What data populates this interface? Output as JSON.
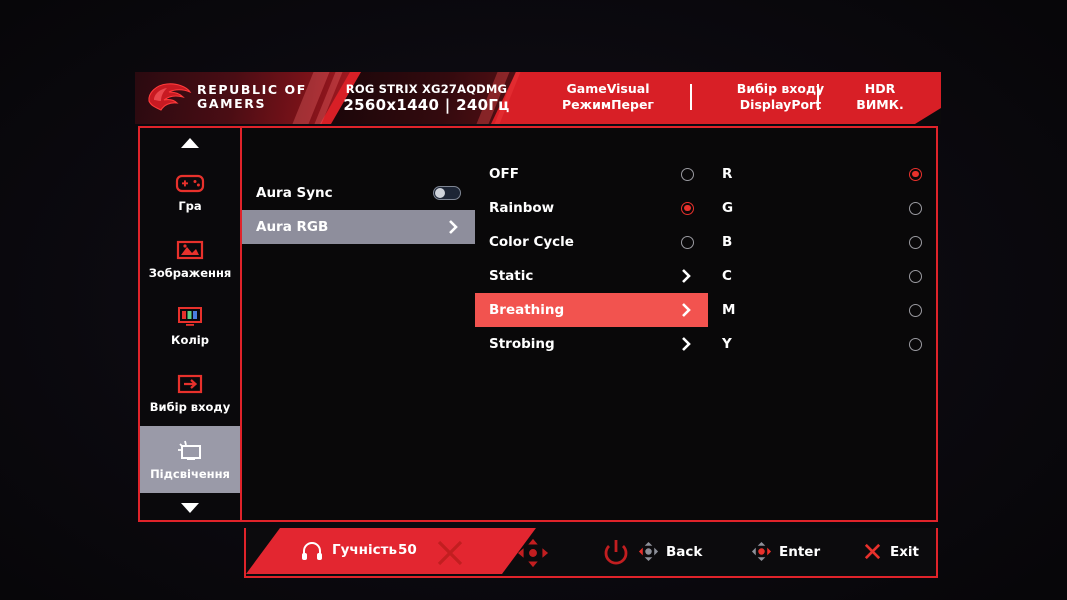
{
  "header": {
    "logo_text_line1": "REPUBLIC OF",
    "logo_text_line2": "GAMERS",
    "model_name": "ROG STRIX XG27AQDMG",
    "model_spec": "2560x1440  |  240Гц",
    "items": [
      {
        "label": "GameVisual",
        "value": "РежимПерег"
      },
      {
        "label": "Вибір входу",
        "value": "DisplayPort"
      },
      {
        "label": "HDR",
        "value": "ВИМК."
      }
    ]
  },
  "sidebar": {
    "scroll_up": "scroll-up-arrow",
    "scroll_down": "scroll-down-arrow",
    "items": [
      {
        "label": "Гра",
        "icon": "gamepad-icon",
        "selected": false
      },
      {
        "label": "Зображення",
        "icon": "image-icon",
        "selected": false
      },
      {
        "label": "Колір",
        "icon": "color-bars-icon",
        "selected": false
      },
      {
        "label": "Вибір входу",
        "icon": "input-arrow-icon",
        "selected": false
      },
      {
        "label": "Підсвічення",
        "icon": "lighting-monitor-icon",
        "selected": true
      }
    ]
  },
  "column2": {
    "rows": [
      {
        "label": "Aura Sync",
        "control": "toggle",
        "value": "off",
        "selected": false
      },
      {
        "label": "Aura RGB",
        "control": "chevron",
        "selected": true
      }
    ]
  },
  "column3": {
    "rows": [
      {
        "label": "OFF",
        "control": "radio",
        "checked": false,
        "selected": false
      },
      {
        "label": "Rainbow",
        "control": "radio",
        "checked": true,
        "selected": false
      },
      {
        "label": "Color Cycle",
        "control": "radio",
        "checked": false,
        "selected": false
      },
      {
        "label": "Static",
        "control": "chevron",
        "selected": false
      },
      {
        "label": "Breathing",
        "control": "chevron",
        "selected": true
      },
      {
        "label": "Strobing",
        "control": "chevron",
        "selected": false
      }
    ]
  },
  "column4": {
    "rows": [
      {
        "label": "R",
        "control": "radio",
        "checked": true
      },
      {
        "label": "G",
        "control": "radio",
        "checked": false
      },
      {
        "label": "B",
        "control": "radio",
        "checked": false
      },
      {
        "label": "C",
        "control": "radio",
        "checked": false
      },
      {
        "label": "M",
        "control": "radio",
        "checked": false
      },
      {
        "label": "Y",
        "control": "radio",
        "checked": false
      }
    ]
  },
  "bottombar": {
    "volume_icon": "headphones-icon",
    "volume_label": "Гучність",
    "volume_value": "50",
    "actions": [
      {
        "label": "Back",
        "icon": "dpad-left-icon"
      },
      {
        "label": "Enter",
        "icon": "dpad-right-icon"
      },
      {
        "label": "Exit",
        "icon": "close-x-icon"
      }
    ]
  },
  "physical_buttons": [
    {
      "name": "close-x-button",
      "icon": "x-icon"
    },
    {
      "name": "joystick-button",
      "icon": "dpad-icon"
    },
    {
      "name": "power-button",
      "icon": "power-icon"
    }
  ],
  "colors": {
    "brand_red": "#d81f26",
    "highlight_red": "#f2534f",
    "highlight_grey": "#8e8e9c",
    "accent_border": "#e0232a"
  }
}
